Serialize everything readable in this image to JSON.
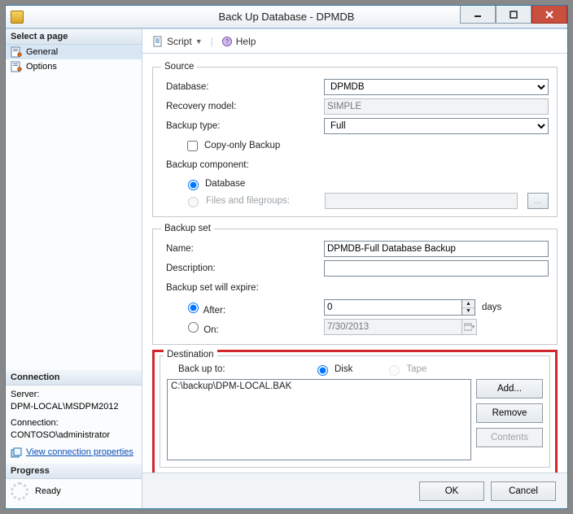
{
  "title": "Back Up Database - DPMDB",
  "toolbar": {
    "script": "Script",
    "help": "Help"
  },
  "left": {
    "pages_head": "Select a page",
    "page_general": "General",
    "page_options": "Options",
    "connection_head": "Connection",
    "server_label": "Server:",
    "server_value": "DPM-LOCAL\\MSDPM2012",
    "connection_label": "Connection:",
    "connection_value": "CONTOSO\\administrator",
    "view_conn_props": "View connection properties",
    "progress_head": "Progress",
    "progress_status": "Ready"
  },
  "source": {
    "legend": "Source",
    "database_label": "Database:",
    "database_value": "DPMDB",
    "recovery_label": "Recovery model:",
    "recovery_value": "SIMPLE",
    "backup_type_label": "Backup type:",
    "backup_type_value": "Full",
    "copy_only": "Copy-only Backup",
    "component_label": "Backup component:",
    "component_database": "Database",
    "component_files": "Files and filegroups:"
  },
  "set": {
    "legend": "Backup set",
    "name_label": "Name:",
    "name_value": "DPMDB-Full Database Backup",
    "desc_label": "Description:",
    "desc_value": "",
    "expire_label": "Backup set will expire:",
    "after_label": "After:",
    "after_value": "0",
    "days_label": "days",
    "on_label": "On:",
    "on_value": "7/30/2013"
  },
  "dest": {
    "legend": "Destination",
    "backup_to": "Back up to:",
    "disk": "Disk",
    "tape": "Tape",
    "path": "C:\\backup\\DPM-LOCAL.BAK",
    "add": "Add...",
    "remove": "Remove",
    "contents": "Contents"
  },
  "footer": {
    "ok": "OK",
    "cancel": "Cancel"
  }
}
